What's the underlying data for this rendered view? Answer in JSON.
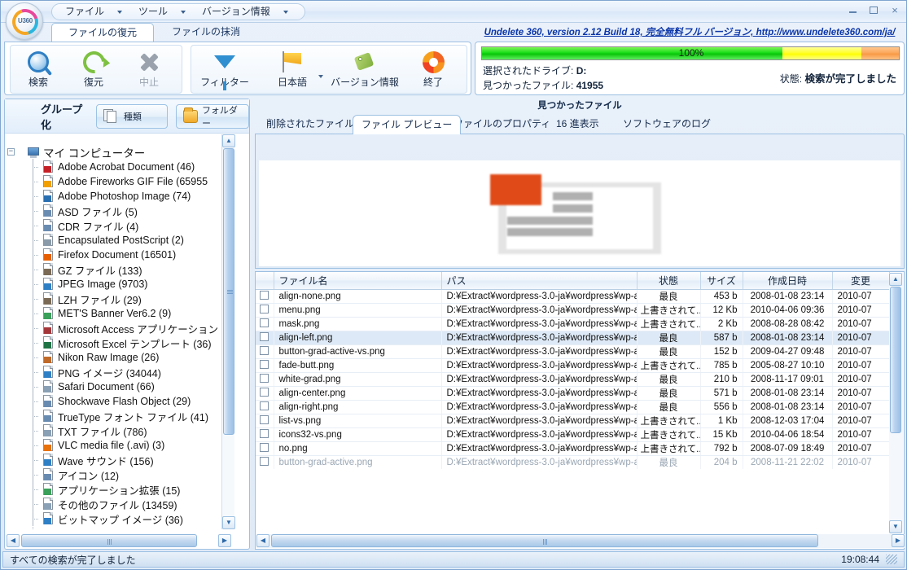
{
  "window": {
    "minimize": "–",
    "maximize": "❑",
    "close": "×",
    "logo_text": "U360"
  },
  "menu": {
    "items": [
      {
        "label": "ファイル"
      },
      {
        "label": "ツール"
      },
      {
        "label": "バージョン情報"
      }
    ]
  },
  "top_tabs": [
    {
      "label": "ファイルの復元",
      "active": true
    },
    {
      "label": "ファイルの抹消",
      "active": false
    }
  ],
  "toolbar": {
    "group1": [
      {
        "label": "検索",
        "icon": "search-icon",
        "disabled": false
      },
      {
        "label": "復元",
        "icon": "restore-icon",
        "disabled": false
      },
      {
        "label": "中止",
        "icon": "stop-icon",
        "disabled": true
      }
    ],
    "group2": [
      {
        "label": "フィルター",
        "icon": "filter-icon",
        "dropdown": false
      },
      {
        "label": "日本語",
        "icon": "language-flag-icon",
        "dropdown": true
      },
      {
        "label": "バージョン情報",
        "icon": "tag-icon",
        "dropdown": false
      },
      {
        "label": "終了",
        "icon": "exit-icon",
        "dropdown": false
      }
    ]
  },
  "header": {
    "product_link": "Undelete 360, version 2.12 Build 18, 完全無料フル バージョン, http://www.undelete360.com/ja/",
    "progress_percent": "100%",
    "progress_value": 100,
    "drive_label": "選択されたドライブ:",
    "drive_value": "D:",
    "found_label": "見つかったファイル:",
    "found_value": "41955",
    "state_label": "状態:",
    "state_value": "検索が完了しました"
  },
  "sidebar": {
    "group_label": "グループ化",
    "group_buttons": [
      {
        "label": "種類",
        "icon": "pages-icon"
      },
      {
        "label": "フォルダー",
        "icon": "folder-icon"
      }
    ],
    "root": {
      "label": "マイ コンピューター",
      "icon": "computer-icon",
      "expander": "−"
    },
    "items": [
      {
        "label": "Adobe Acrobat Document (46)",
        "icon": "pdf-icon",
        "color": "#c42127"
      },
      {
        "label": "Adobe Fireworks GIF File (65955",
        "icon": "fireworks-icon",
        "color": "#f0a000"
      },
      {
        "label": "Adobe Photoshop Image (74)",
        "icon": "photoshop-icon",
        "color": "#2a6fb0"
      },
      {
        "label": "ASD ファイル (5)",
        "icon": "generic-file-icon",
        "color": "#6a8bb0"
      },
      {
        "label": "CDR ファイル (4)",
        "icon": "generic-file-icon",
        "color": "#6a8bb0"
      },
      {
        "label": "Encapsulated PostScript (2)",
        "icon": "eps-icon",
        "color": "#8a9aa8"
      },
      {
        "label": "Firefox Document (16501)",
        "icon": "firefox-icon",
        "color": "#e66000"
      },
      {
        "label": "GZ ファイル (133)",
        "icon": "archive-icon",
        "color": "#7a6a55"
      },
      {
        "label": "JPEG Image (9703)",
        "icon": "image-icon",
        "color": "#2f7fc4"
      },
      {
        "label": "LZH ファイル (29)",
        "icon": "archive-icon",
        "color": "#7a6a55"
      },
      {
        "label": "MET'S Banner Ver6.2 (9)",
        "icon": "banner-icon",
        "color": "#3aa05a"
      },
      {
        "label": "Microsoft Access アプリケーション",
        "icon": "access-icon",
        "color": "#a4373a"
      },
      {
        "label": "Microsoft Excel テンプレート (36)",
        "icon": "excel-icon",
        "color": "#1f7244"
      },
      {
        "label": "Nikon Raw Image (26)",
        "icon": "raw-image-icon",
        "color": "#c06a2a"
      },
      {
        "label": "PNG イメージ (34044)",
        "icon": "png-icon",
        "color": "#2f7fc4"
      },
      {
        "label": "Safari Document (66)",
        "icon": "safari-icon",
        "color": "#8aa0b4"
      },
      {
        "label": "Shockwave Flash Object (29)",
        "icon": "flash-icon",
        "color": "#6a8bb0"
      },
      {
        "label": "TrueType フォント ファイル (41)",
        "icon": "font-icon",
        "color": "#6a8bb0"
      },
      {
        "label": "TXT ファイル (786)",
        "icon": "text-icon",
        "color": "#8aa0b4"
      },
      {
        "label": "VLC media file (.avi) (3)",
        "icon": "vlc-cone-icon",
        "color": "#e8720c"
      },
      {
        "label": "Wave サウンド (156)",
        "icon": "sound-icon",
        "color": "#2f7fc4"
      },
      {
        "label": "アイコン (12)",
        "icon": "icon-file-icon",
        "color": "#6a8bb0"
      },
      {
        "label": "アプリケーション拡張 (15)",
        "icon": "dll-icon",
        "color": "#3aa05a"
      },
      {
        "label": "その他のファイル (13459)",
        "icon": "other-file-icon",
        "color": "#8aa0b4"
      },
      {
        "label": "ビットマップ イメージ (36)",
        "icon": "bitmap-icon",
        "color": "#2f7fc4"
      }
    ]
  },
  "main": {
    "panel_title": "見つかったファイル",
    "tabs": [
      {
        "label": "削除されたファイル",
        "active": false
      },
      {
        "label": "ファイル プレビュー",
        "active": true
      },
      {
        "label": "ファイルのプロパティ",
        "active": false
      },
      {
        "label": "16 進表示",
        "active": false
      },
      {
        "label": "ソフトウェアのログ",
        "active": false
      }
    ],
    "columns": [
      {
        "label": "",
        "key": "check"
      },
      {
        "label": "ファイル名",
        "key": "name"
      },
      {
        "label": "パス",
        "key": "path"
      },
      {
        "label": "状態",
        "key": "state"
      },
      {
        "label": "サイズ",
        "key": "size"
      },
      {
        "label": "作成日時",
        "key": "created"
      },
      {
        "label": "変更",
        "key": "modified"
      }
    ],
    "rows": [
      {
        "name": "align-none.png",
        "path": "D:¥Extract¥wordpress-3.0-ja¥wordpress¥wp-ad...",
        "state": "最良",
        "ok": true,
        "size": "453 b",
        "created": "2008-01-08 23:14",
        "modified": "2010-07",
        "selected": false
      },
      {
        "name": "menu.png",
        "path": "D:¥Extract¥wordpress-3.0-ja¥wordpress¥wp-ad...",
        "state": "上書きされて...",
        "ok": false,
        "size": "12 Kb",
        "created": "2010-04-06 09:36",
        "modified": "2010-07",
        "selected": false
      },
      {
        "name": "mask.png",
        "path": "D:¥Extract¥wordpress-3.0-ja¥wordpress¥wp-ad...",
        "state": "上書きされて...",
        "ok": false,
        "size": "2 Kb",
        "created": "2008-08-28 08:42",
        "modified": "2010-07",
        "selected": false
      },
      {
        "name": "align-left.png",
        "path": "D:¥Extract¥wordpress-3.0-ja¥wordpress¥wp-ad...",
        "state": "最良",
        "ok": true,
        "size": "587 b",
        "created": "2008-01-08 23:14",
        "modified": "2010-07",
        "selected": true
      },
      {
        "name": "button-grad-active-vs.png",
        "path": "D:¥Extract¥wordpress-3.0-ja¥wordpress¥wp-ad...",
        "state": "最良",
        "ok": true,
        "size": "152 b",
        "created": "2009-04-27 09:48",
        "modified": "2010-07",
        "selected": false
      },
      {
        "name": "fade-butt.png",
        "path": "D:¥Extract¥wordpress-3.0-ja¥wordpress¥wp-ad...",
        "state": "上書きされて...",
        "ok": false,
        "size": "785 b",
        "created": "2005-08-27 10:10",
        "modified": "2010-07",
        "selected": false
      },
      {
        "name": "white-grad.png",
        "path": "D:¥Extract¥wordpress-3.0-ja¥wordpress¥wp-ad...",
        "state": "最良",
        "ok": true,
        "size": "210 b",
        "created": "2008-11-17 09:01",
        "modified": "2010-07",
        "selected": false
      },
      {
        "name": "align-center.png",
        "path": "D:¥Extract¥wordpress-3.0-ja¥wordpress¥wp-ad...",
        "state": "最良",
        "ok": true,
        "size": "571 b",
        "created": "2008-01-08 23:14",
        "modified": "2010-07",
        "selected": false
      },
      {
        "name": "align-right.png",
        "path": "D:¥Extract¥wordpress-3.0-ja¥wordpress¥wp-ad...",
        "state": "最良",
        "ok": true,
        "size": "556 b",
        "created": "2008-01-08 23:14",
        "modified": "2010-07",
        "selected": false
      },
      {
        "name": "list-vs.png",
        "path": "D:¥Extract¥wordpress-3.0-ja¥wordpress¥wp-ad...",
        "state": "上書きされて...",
        "ok": false,
        "size": "1 Kb",
        "created": "2008-12-03 17:04",
        "modified": "2010-07",
        "selected": false
      },
      {
        "name": "icons32-vs.png",
        "path": "D:¥Extract¥wordpress-3.0-ja¥wordpress¥wp-ad...",
        "state": "上書きされて...",
        "ok": false,
        "size": "15 Kb",
        "created": "2010-04-06 18:54",
        "modified": "2010-07",
        "selected": false
      },
      {
        "name": "no.png",
        "path": "D:¥Extract¥wordpress-3.0-ja¥wordpress¥wp-ad...",
        "state": "上書きされて...",
        "ok": false,
        "size": "792 b",
        "created": "2008-07-09 18:49",
        "modified": "2010-07",
        "selected": false
      },
      {
        "name": "button-grad-active.png",
        "path": "D:¥Extract¥wordpress-3.0-ja¥wordpress¥wp-ad...",
        "state": "最良",
        "ok": true,
        "size": "204 b",
        "created": "2008-11-21 22:02",
        "modified": "2010-07",
        "selected": false,
        "partial": true
      }
    ]
  },
  "statusbar": {
    "message": "すべての検索が完了しました",
    "clock": "19:08:44"
  },
  "colors": {
    "accent": "#2f7fc4",
    "link": "#0b35a8",
    "status_ok": "#0b8a23",
    "status_bad": "#dd1414",
    "progress_green": "#19dd19",
    "progress_yellow": "#fdfd05",
    "progress_orange": "#f79a45"
  }
}
